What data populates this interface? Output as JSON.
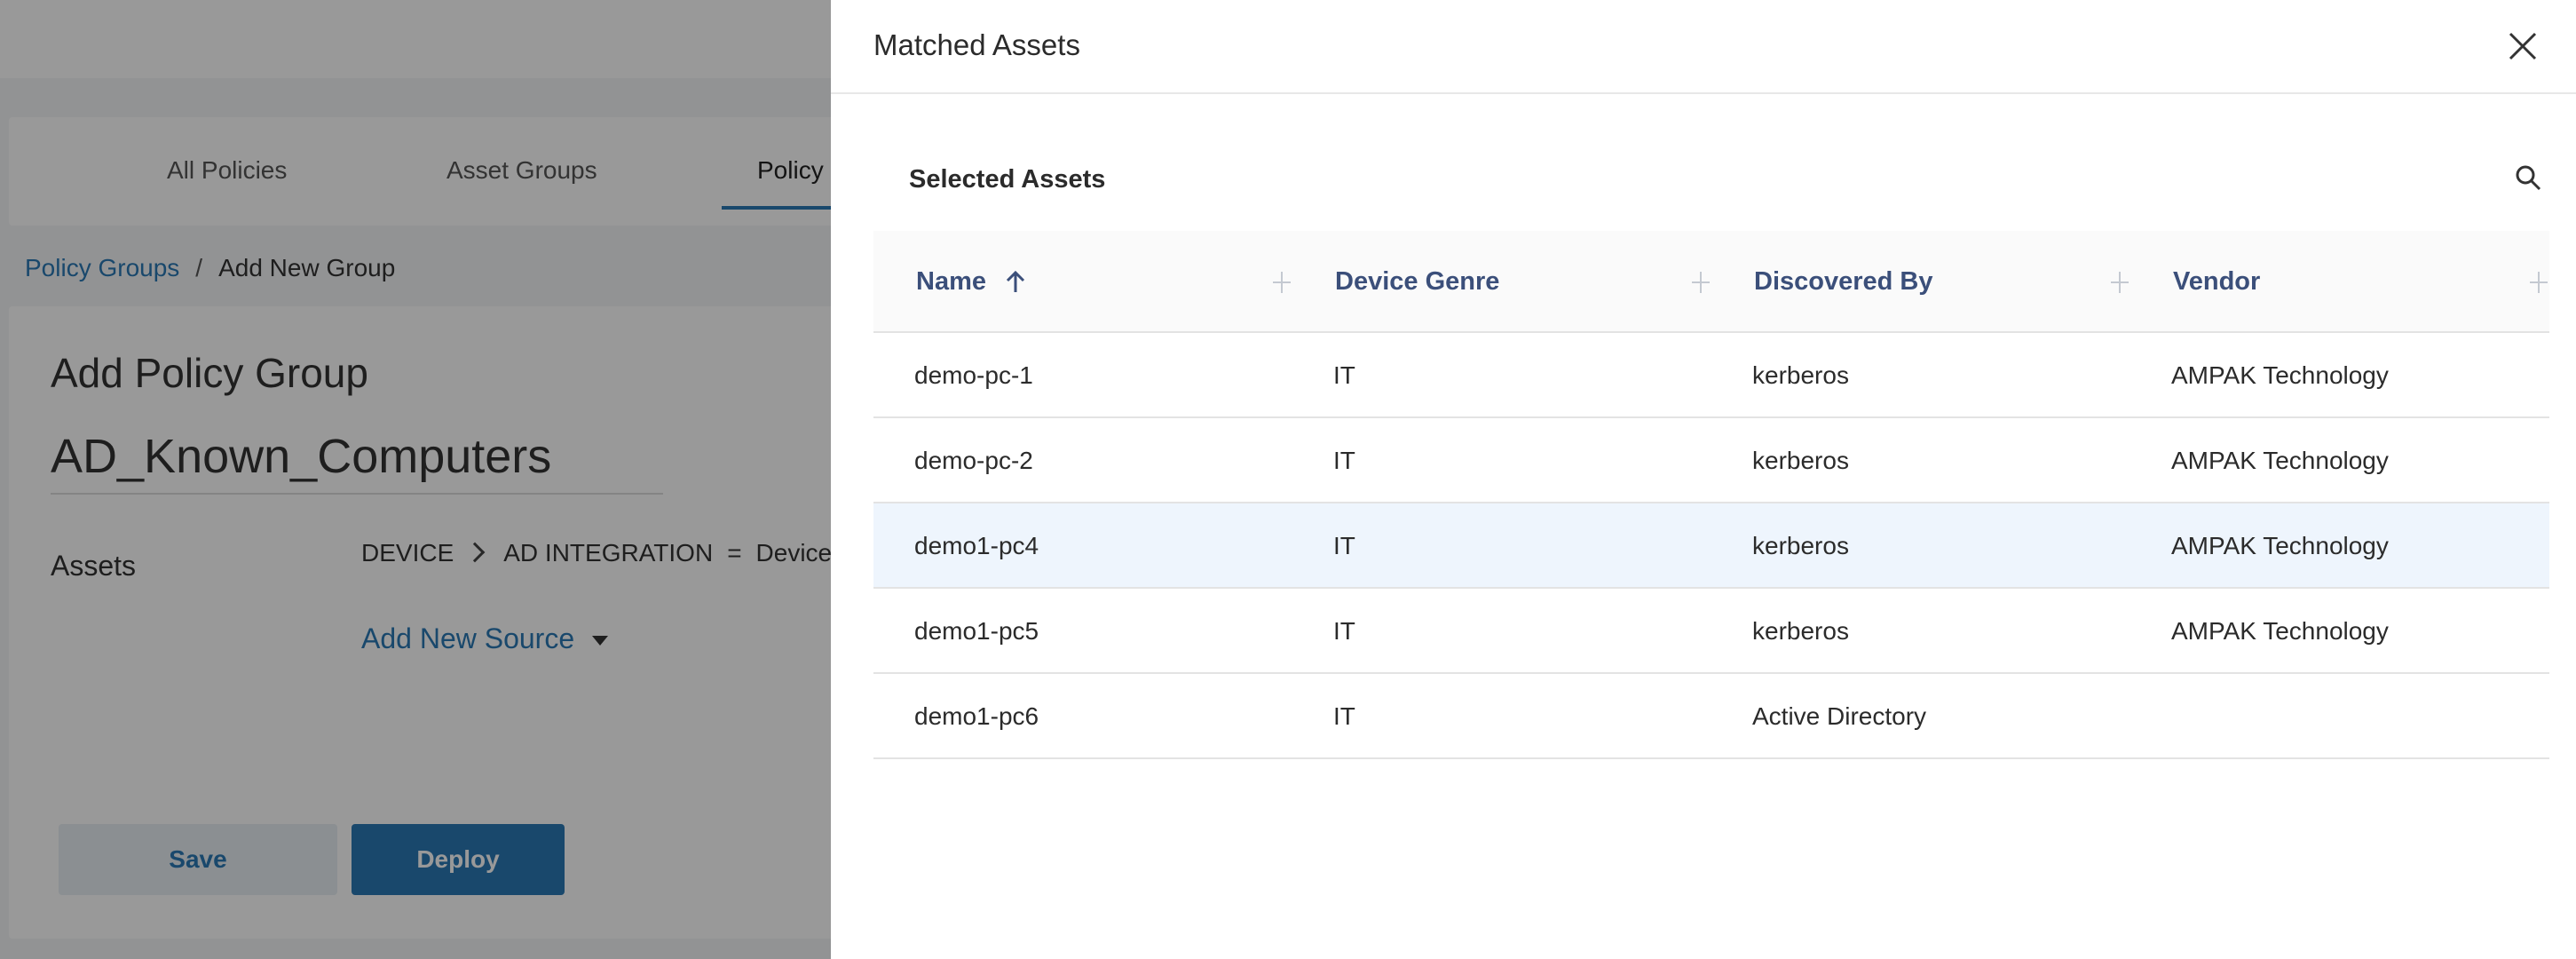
{
  "background": {
    "tabs": [
      "All Policies",
      "Asset Groups",
      "Policy"
    ],
    "breadcrumb": {
      "parent": "Policy Groups",
      "separator": "/",
      "current": "Add New Group"
    },
    "card_title": "Add Policy Group",
    "group_name": "AD_Known_Computers",
    "assets_label": "Assets",
    "rule": {
      "field": "DEVICE",
      "sub_field": "AD INTEGRATION",
      "operator": "=",
      "value": "Device"
    },
    "add_source_label": "Add New Source",
    "save_label": "Save",
    "deploy_label": "Deploy"
  },
  "drawer": {
    "title": "Matched Assets",
    "section_title": "Selected Assets",
    "columns": [
      "Name",
      "Device Genre",
      "Discovered By",
      "Vendor"
    ],
    "sort": {
      "column": "Name",
      "direction": "ascending"
    },
    "rows": [
      {
        "name": "demo-pc-1",
        "genre": "IT",
        "discovered_by": "kerberos",
        "vendor": "AMPAK Technology"
      },
      {
        "name": "demo-pc-2",
        "genre": "IT",
        "discovered_by": "kerberos",
        "vendor": "AMPAK Technology"
      },
      {
        "name": "demo1-pc4",
        "genre": "IT",
        "discovered_by": "kerberos",
        "vendor": "AMPAK Technology"
      },
      {
        "name": "demo1-pc5",
        "genre": "IT",
        "discovered_by": "kerberos",
        "vendor": "AMPAK Technology"
      },
      {
        "name": "demo1-pc6",
        "genre": "IT",
        "discovered_by": "Active Directory",
        "vendor": ""
      }
    ],
    "highlighted_row": 2
  },
  "icons": [
    "close-icon",
    "search-icon",
    "sort-ascending-icon",
    "column-resize-icon",
    "chevron-right-icon",
    "caret-down-icon"
  ],
  "colors": {
    "accent": "#2b79b5",
    "column_header_text": "#3b4f7a",
    "highlight_row": "#eef5fd"
  }
}
